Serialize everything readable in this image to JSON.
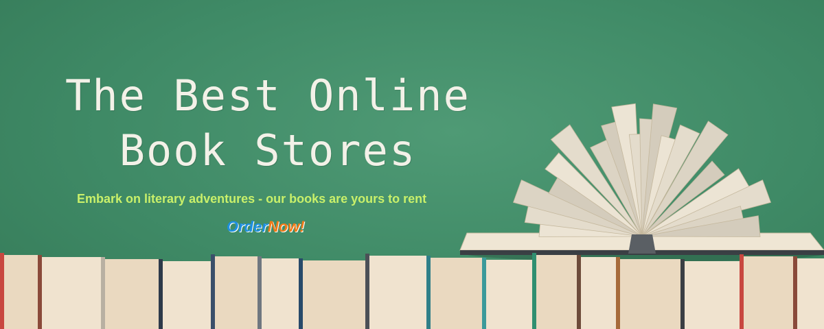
{
  "banner": {
    "title_line1": "The Best Online",
    "title_line2": "Book Stores",
    "tagline": "Embark on literary adventures - our books are yours to rent",
    "cta": {
      "word1": "Order",
      "word2": "Now!"
    },
    "colors": {
      "background": "#3f8a66",
      "title": "#f3f1e8",
      "tagline": "#c9f06a",
      "cta_order": "#1d8fe0",
      "cta_now": "#f07a18"
    },
    "images": [
      "open-book-illustration",
      "book-spines-row"
    ]
  }
}
